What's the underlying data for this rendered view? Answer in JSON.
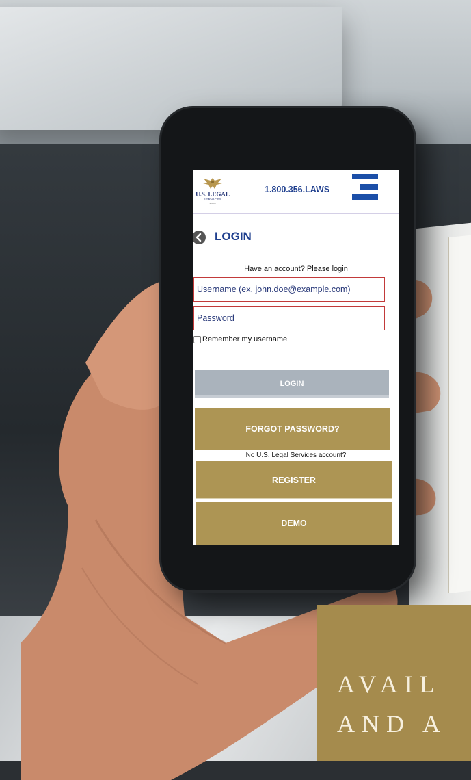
{
  "header": {
    "logo_text": "U.S. LEGAL",
    "logo_subtext": "SERVICES",
    "logo_tiny": "SINCE",
    "phone": "1.800.356.LAWS",
    "menu_icon": "hamburger-menu-icon"
  },
  "login": {
    "back_icon": "chevron-left-icon",
    "title": "LOGIN",
    "prompt": "Have an account? Please login",
    "username_placeholder": "Username (ex. john.doe@example.com)",
    "password_placeholder": "Password",
    "remember_label": "Remember my username",
    "login_button": "LOGIN",
    "forgot_button": "FORGOT PASSWORD?",
    "no_account_text": "No U.S. Legal Services account?",
    "register_button": "REGISTER",
    "demo_button": "DEMO"
  },
  "banner": {
    "line1": "AVAIL",
    "line2": "AND A"
  },
  "colors": {
    "brand_blue": "#1f3f8e",
    "gold": "#ad9554",
    "disabled_gray": "#aab3bc",
    "error_red": "#c23a3a"
  }
}
